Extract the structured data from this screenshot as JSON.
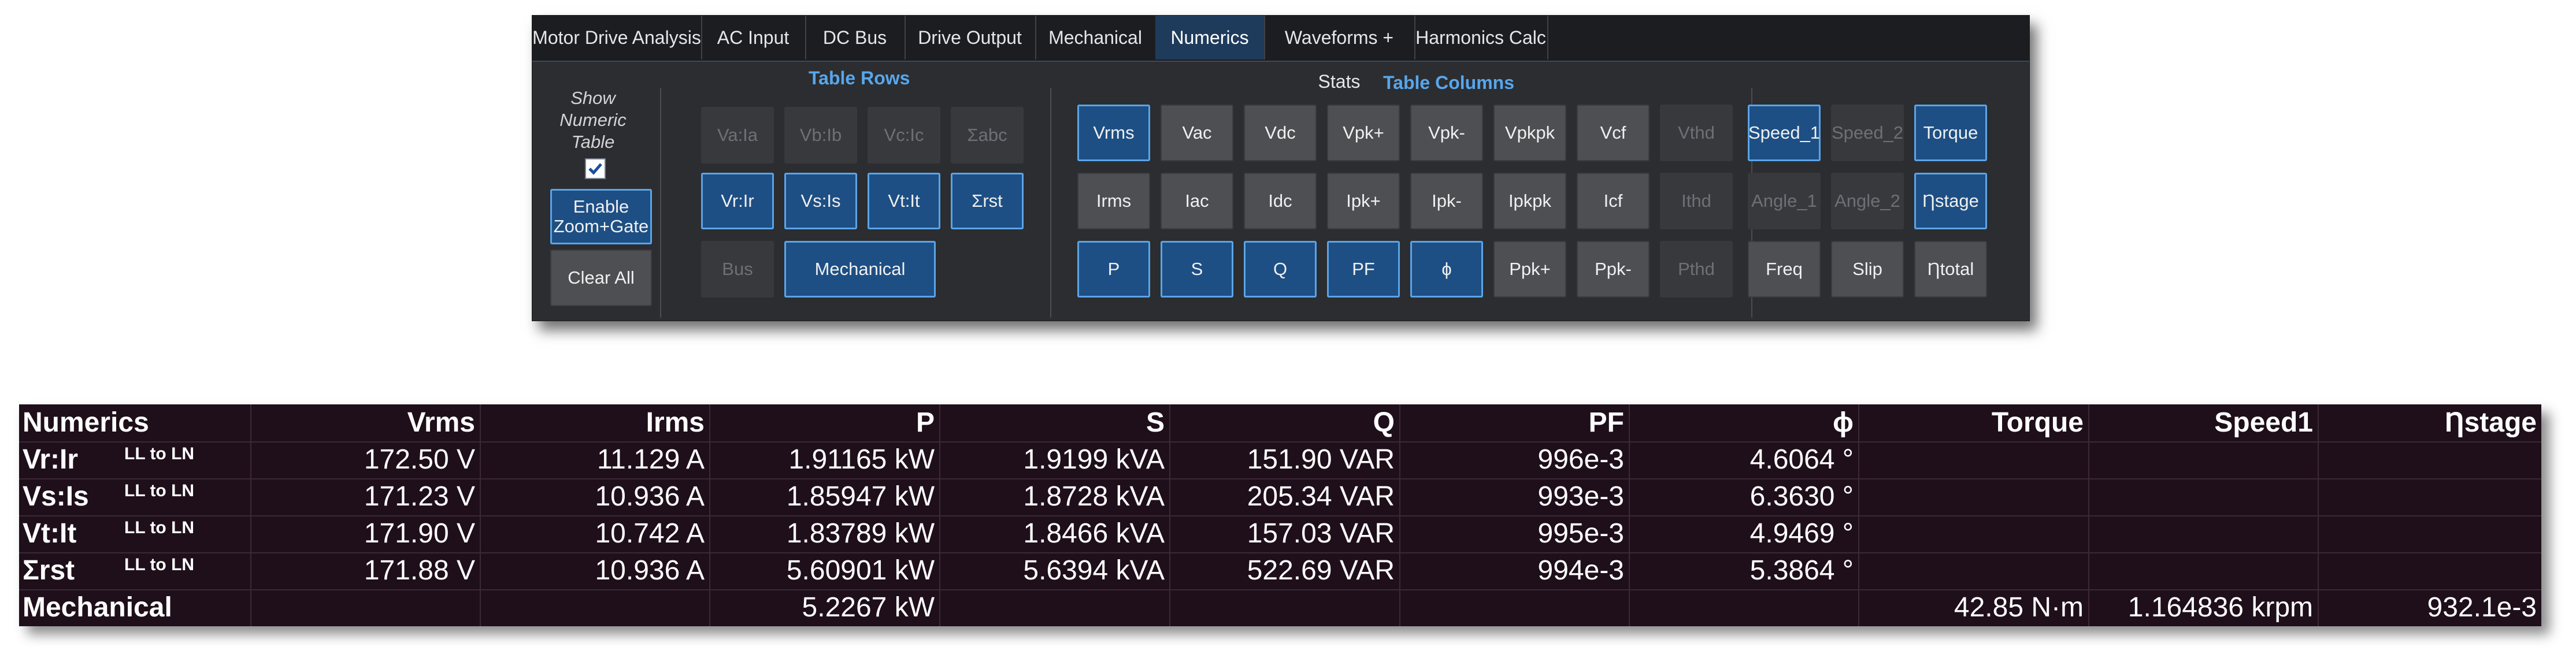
{
  "tabs": [
    "Motor Drive Analysis",
    "AC Input",
    "DC Bus",
    "Drive Output",
    "Mechanical",
    "Numerics",
    "Waveforms + Stats",
    "Harmonics Calc"
  ],
  "active_tab": "Numerics",
  "show_numeric_label": [
    "Show",
    "Numeric",
    "Table"
  ],
  "show_numeric_checked": true,
  "enable_zoom_label": [
    "Enable",
    "Zoom+Gate"
  ],
  "clear_all_label": "Clear All",
  "table_rows_title": "Table Rows",
  "table_columns_title": "Table Columns",
  "row_buttons": {
    "va_ia": "Va:Ia",
    "vb_ib": "Vb:Ib",
    "vc_ic": "Vc:Ic",
    "sigma_abc": "Σabc",
    "vr_ir": "Vr:Ir",
    "vs_is": "Vs:Is",
    "vt_it": "Vt:It",
    "sigma_rst": "Σrst",
    "bus": "Bus",
    "mechanical": "Mechanical"
  },
  "column_buttons": {
    "vrms": "Vrms",
    "vac": "Vac",
    "vdc": "Vdc",
    "vpk_plus": "Vpk+",
    "vpk_minus": "Vpk-",
    "vpkpk": "Vpkpk",
    "vcf": "Vcf",
    "vthd": "Vthd",
    "irms": "Irms",
    "iac": "Iac",
    "idc": "Idc",
    "ipk_plus": "Ipk+",
    "ipk_minus": "Ipk-",
    "ipkpk": "Ipkpk",
    "icf": "Icf",
    "ithd": "Ithd",
    "p": "P",
    "s": "S",
    "q": "Q",
    "pf": "PF",
    "phi": "ϕ",
    "ppk_plus": "Ppk+",
    "ppk_minus": "Ppk-",
    "pthd": "Pthd",
    "speed_1": "Speed_1",
    "speed_2": "Speed_2",
    "torque": "Torque",
    "angle_1": "Angle_1",
    "angle_2": "Angle_2",
    "eta_stage": "Ƞstage",
    "freq": "Freq",
    "slip": "Slip",
    "eta_total": "Ƞtotal"
  },
  "numerics_table": {
    "headers": [
      "Numerics",
      "Vrms",
      "Irms",
      "P",
      "S",
      "Q",
      "PF",
      "ϕ",
      "Torque",
      "Speed1",
      "Ƞstage"
    ],
    "rows": [
      {
        "label": "Vr:Ir",
        "sub": "LL to LN",
        "cells": [
          "172.50 V",
          "11.129 A",
          "1.91165 kW",
          "1.9199 kVA",
          "151.90 VAR",
          "996e-3",
          "4.6064 °",
          "",
          "",
          ""
        ]
      },
      {
        "label": "Vs:Is",
        "sub": "LL to LN",
        "cells": [
          "171.23 V",
          "10.936 A",
          "1.85947 kW",
          "1.8728 kVA",
          "205.34 VAR",
          "993e-3",
          "6.3630 °",
          "",
          "",
          ""
        ]
      },
      {
        "label": "Vt:It",
        "sub": "LL to LN",
        "cells": [
          "171.90 V",
          "10.742 A",
          "1.83789 kW",
          "1.8466 kVA",
          "157.03 VAR",
          "995e-3",
          "4.9469 °",
          "",
          "",
          ""
        ]
      },
      {
        "label": "Σrst",
        "sub": "LL to LN",
        "cells": [
          "171.88 V",
          "10.936 A",
          "5.60901 kW",
          "5.6394 kVA",
          "522.69 VAR",
          "994e-3",
          "5.3864 °",
          "",
          "",
          ""
        ]
      },
      {
        "label": "Mechanical",
        "sub": "",
        "cells": [
          "",
          "",
          "5.2267 kW",
          "",
          "",
          "",
          "",
          "42.85 N·m",
          "1.164836 krpm",
          "932.1e-3"
        ]
      }
    ]
  },
  "colors": {
    "accent": "#58a6ec",
    "selected": "#1d4f84",
    "table_bg": "#1e0f1a"
  }
}
